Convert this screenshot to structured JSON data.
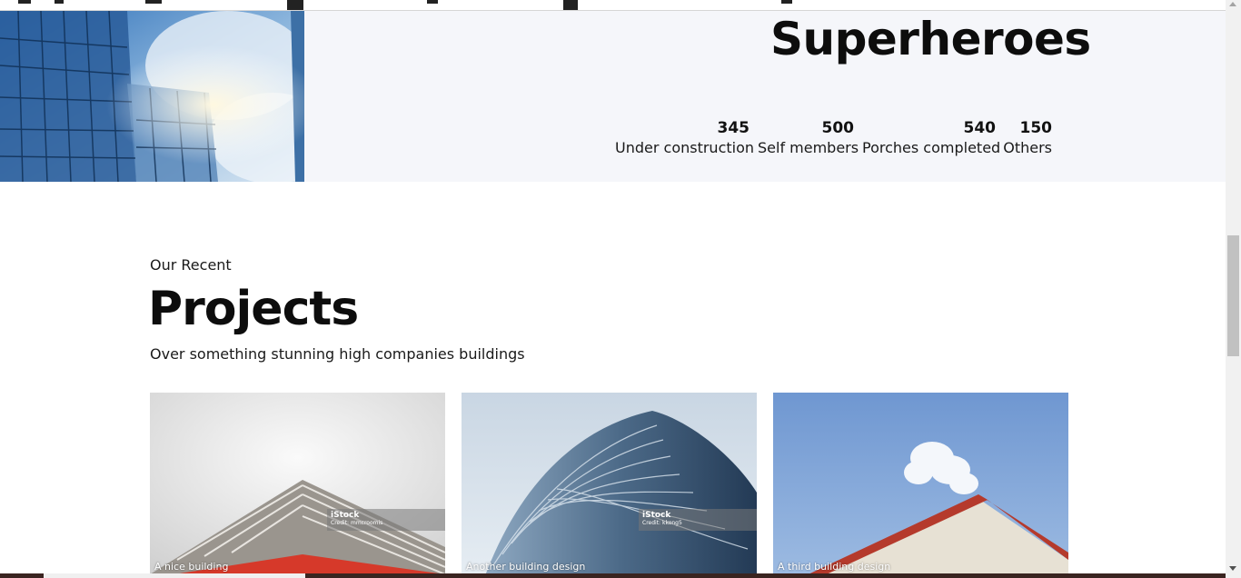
{
  "hero": {
    "title": "Superheroes",
    "stats": [
      {
        "value": "345",
        "label": "Under construction"
      },
      {
        "value": "500",
        "label": "Self members"
      },
      {
        "value": "540",
        "label": "Porches completed"
      },
      {
        "value": "150",
        "label": "Others"
      }
    ]
  },
  "projects_section": {
    "eyebrow": "Our Recent",
    "title": "Projects",
    "subtitle": "Over something stunning high companies buildings",
    "cards": [
      {
        "caption": "A nice building",
        "watermark_brand": "iStock",
        "watermark_credit": "Credit: mmcroomis"
      },
      {
        "caption": "Another building design",
        "watermark_brand": "iStock",
        "watermark_credit": "Credit: kkong5"
      },
      {
        "caption": "A third building design"
      }
    ]
  }
}
